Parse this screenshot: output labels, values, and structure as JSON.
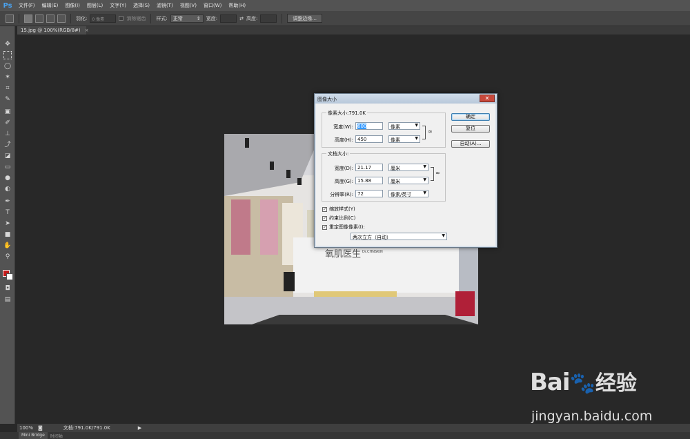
{
  "app": {
    "logo": "Ps"
  },
  "menu": [
    "文件(F)",
    "编辑(E)",
    "图像(I)",
    "图层(L)",
    "文字(Y)",
    "选择(S)",
    "滤镜(T)",
    "视图(V)",
    "窗口(W)",
    "帮助(H)"
  ],
  "options_bar": {
    "feather_label": "羽化:",
    "feather_value": "0 像素",
    "antialias_label": "消除锯齿",
    "style_label": "样式:",
    "style_value": "正常",
    "width_label": "宽度:",
    "height_label": "高度:",
    "refine_button": "调整边缘..."
  },
  "document_tab": {
    "title": "15.jpg @ 100%(RGB/8#)",
    "close": "×"
  },
  "status_bar": {
    "zoom": "100%",
    "doc_info": "文档:791.0K/791.0K",
    "arrow": "▶"
  },
  "bottom_panel": {
    "tab1": "Mini Bridge",
    "tab2": "时间轴"
  },
  "colors": {
    "foreground": "#c41a1a",
    "background": "#ffffff"
  },
  "dialog": {
    "title": "图像大小",
    "close": "✕",
    "pixel_dimensions": {
      "legend": "像素大小:791.0K",
      "width_label": "宽度(W):",
      "width_value": "600",
      "width_unit": "像素",
      "height_label": "高度(H):",
      "height_value": "450",
      "height_unit": "像素"
    },
    "document_size": {
      "legend": "文档大小:",
      "width_label": "宽度(D):",
      "width_value": "21.17",
      "width_unit": "厘米",
      "height_label": "高度(G):",
      "height_value": "15.88",
      "height_unit": "厘米",
      "resolution_label": "分辨率(R):",
      "resolution_value": "72",
      "resolution_unit": "像素/英寸"
    },
    "buttons": {
      "ok": "确定",
      "reset": "复位",
      "auto": "自动(A)..."
    },
    "checkboxes": {
      "scale_styles": "缩放样式(Y)",
      "constrain": "约束比例(C)",
      "resample": "重定图像像素(I):"
    },
    "resample_method": "两次立方（自动）"
  },
  "photo": {
    "sign_text": "氧肌医生",
    "brand_text": "Dr.CHNSKIN"
  },
  "watermark": {
    "brand": "Bai",
    "brand2": "经验",
    "url": "jingyan.baidu.com"
  }
}
